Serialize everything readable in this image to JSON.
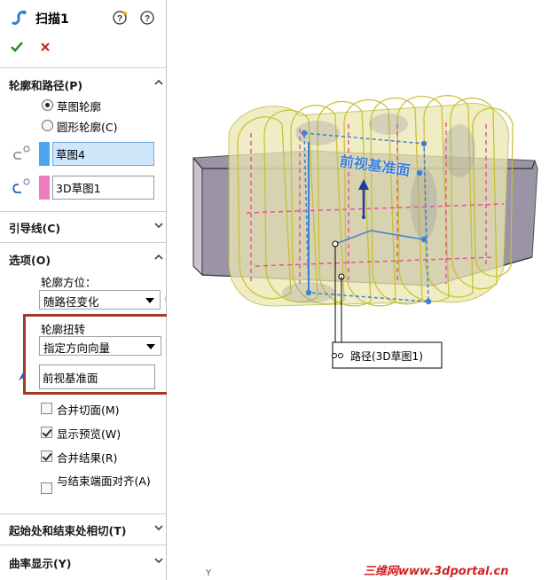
{
  "header": {
    "title": "扫描1"
  },
  "sections": {
    "profile_path": {
      "label": "轮廓和路径(P)"
    },
    "guides": {
      "label": "引导线(C)"
    },
    "options": {
      "label": "选项(O)"
    },
    "tangency": {
      "label": "起始处和结束处相切(T)"
    },
    "curvature": {
      "label": "曲率显示(Y)"
    }
  },
  "profile_type": {
    "sketch_label": "草图轮廓",
    "circle_label": "圆形轮廓(C)",
    "selected": "sketch"
  },
  "profile_field": {
    "value": "草图4",
    "color": "#4da6f0"
  },
  "path_field": {
    "value": "3D草图1",
    "color": "#f07cc0"
  },
  "options": {
    "orientation_label": "轮廓方位：",
    "orientation_value": "随路径变化",
    "twist_label": "轮廓扭转",
    "twist_value": "指定方向向量",
    "direction_value": "前视基准面",
    "merge_tangent": {
      "label": "合并切面(M)",
      "checked": false
    },
    "show_preview": {
      "label": "显示预览(W)",
      "checked": true
    },
    "merge_result": {
      "label": "合并结果(R)",
      "checked": true
    },
    "align_end": {
      "label": "与结束端面对齐(A)",
      "checked": false
    }
  },
  "viewport": {
    "plane_label": "前视基准面",
    "path_callout": "路径(3D草图1)",
    "axis_label": "Y",
    "watermark": "三维网www.3dportal.cn"
  },
  "colors": {
    "accent_blue": "#4da6f0",
    "accent_pink": "#f07cc0",
    "highlight_box": "#a33a22",
    "ok_green": "#2e8b2e",
    "cancel_red": "#cc2020",
    "watermark_red": "#d42020"
  }
}
